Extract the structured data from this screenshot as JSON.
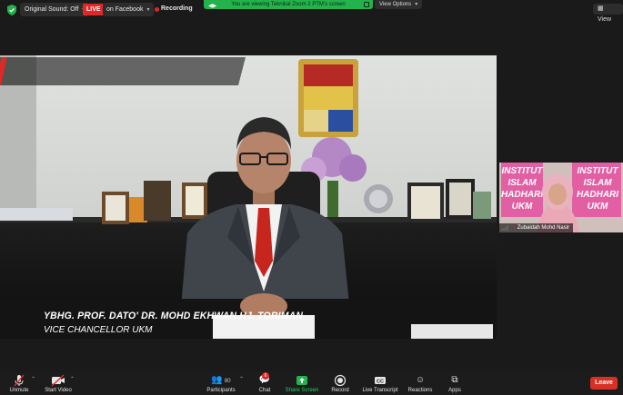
{
  "topbar": {
    "original_sound": "Original Sound: Off",
    "live_badge": "LIVE",
    "live_target": "on Facebook",
    "recording": "Recording",
    "share_banner": "You are viewing Teknikal Zoom 2 PTM's screen",
    "view_options": "View Options",
    "view": "View"
  },
  "main_video": {
    "lower_third_name": "YBHG. PROF. DATO' DR. MOHD EKHWAN HJ. TORIMAN",
    "lower_third_title": "VICE CHANCELLOR UKM"
  },
  "thumbnail": {
    "participant_name": "Zubaidah Mohd Nasir",
    "banner_left_1": "INSTITUT",
    "banner_left_2": "ISLAM",
    "banner_left_3": "HADHARI",
    "banner_left_4": "UKM",
    "banner_right_1": "INSTITUT",
    "banner_right_2": "ISLAM",
    "banner_right_3": "HADHARI",
    "banner_right_4": "UKM"
  },
  "toolbar": {
    "unmute": "Unmute",
    "start_video": "Start Video",
    "participants": "Participants",
    "participants_count": "80",
    "chat": "Chat",
    "chat_badge": "6",
    "share_screen": "Share Screen",
    "record": "Record",
    "live_transcript": "Live Transcript",
    "reactions": "Reactions",
    "apps": "Apps",
    "leave": "Leave"
  },
  "colors": {
    "live_red": "#e02828",
    "share_green": "#23b24b",
    "leave_red": "#d93025",
    "background": "#1a1a1a"
  },
  "icons": [
    "shield-icon",
    "microphone-muted-icon",
    "video-off-icon",
    "participants-icon",
    "chat-icon",
    "share-screen-icon",
    "record-icon",
    "cc-icon",
    "reactions-icon",
    "apps-icon",
    "signal-icon"
  ]
}
